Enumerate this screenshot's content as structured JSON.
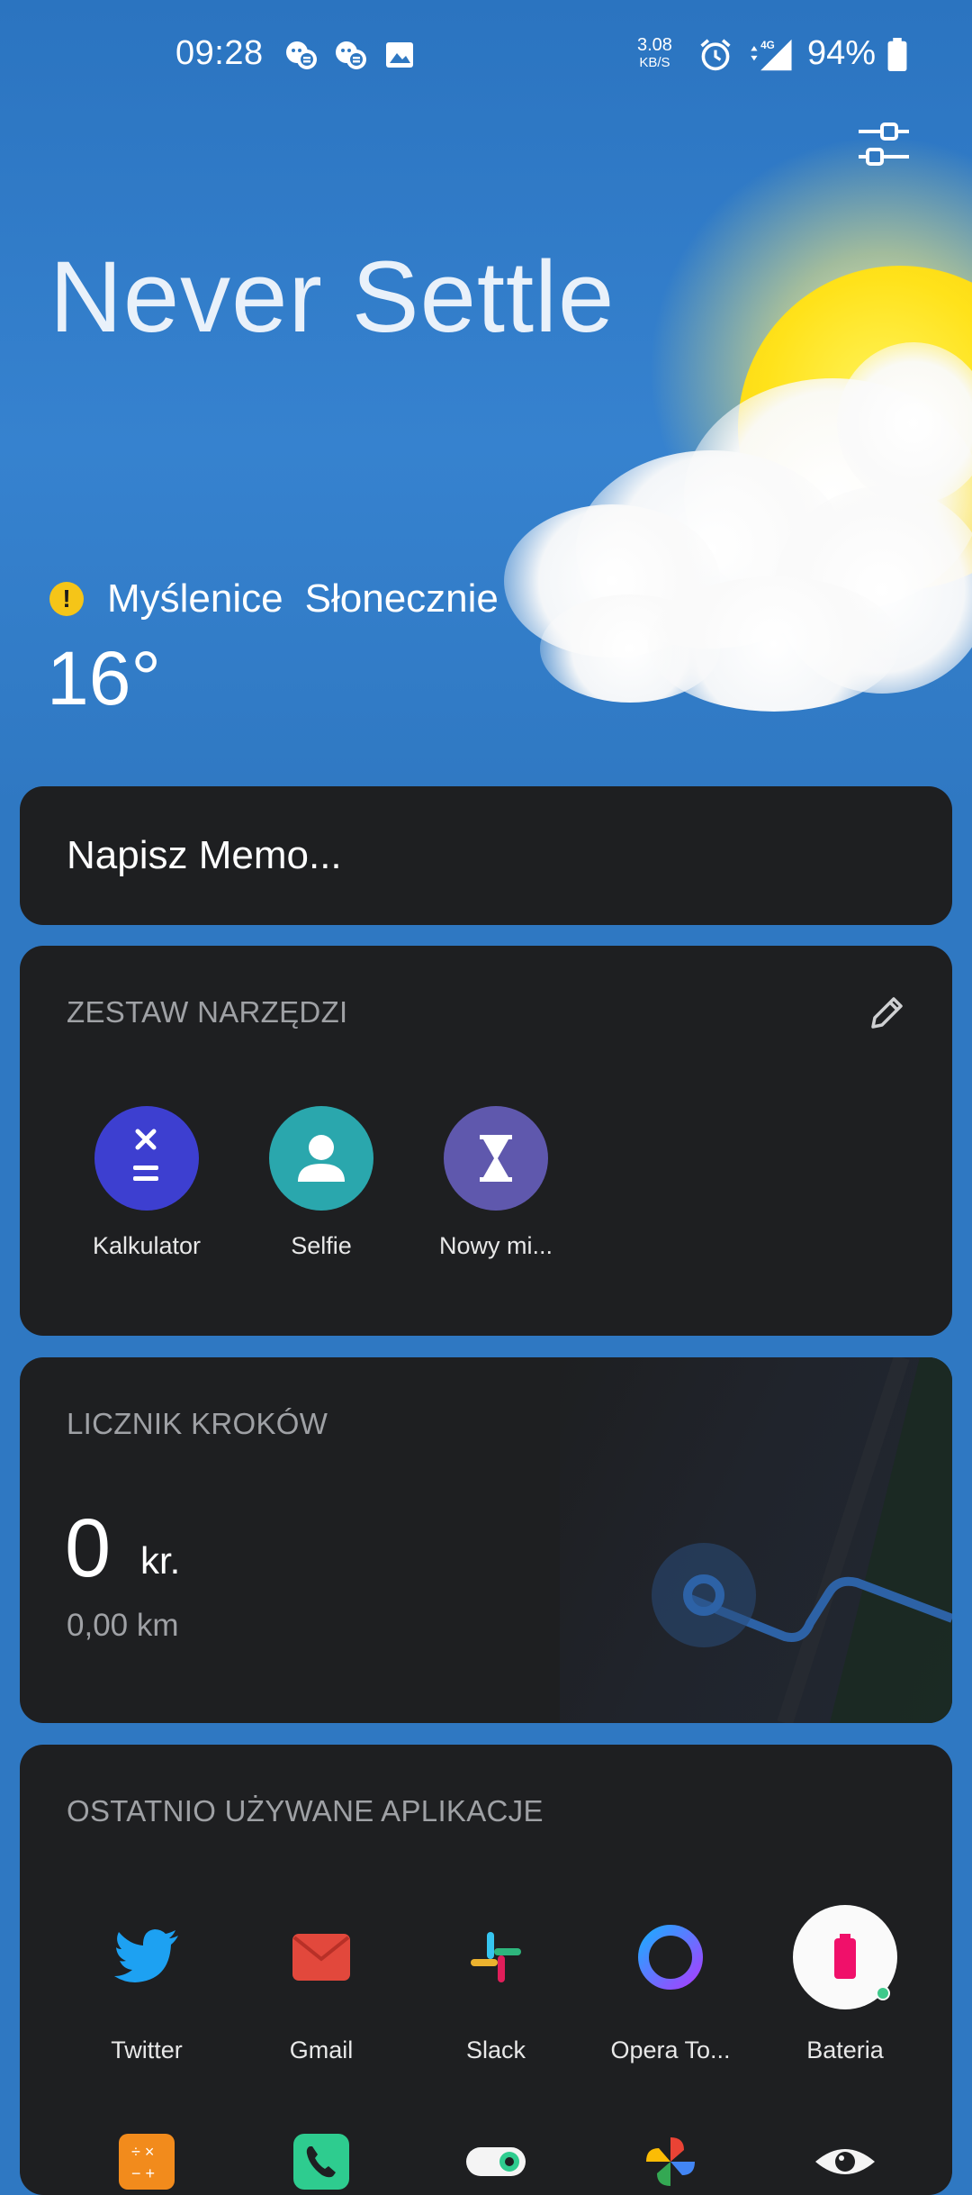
{
  "status_bar": {
    "time": "09:28",
    "net_speed_value": "3.08",
    "net_speed_unit": "KB/S",
    "network": "4G",
    "battery": "94%"
  },
  "header": {
    "slogan": "Never Settle"
  },
  "weather": {
    "city": "Myślenice",
    "condition": "Słonecznie",
    "temperature": "16°",
    "warning_icon": "!"
  },
  "memo": {
    "placeholder": "Napisz Memo..."
  },
  "toolbox": {
    "title": "ZESTAW NARZĘDZI",
    "items": [
      {
        "label": "Kalkulator",
        "icon": "calculator-icon",
        "color": "#3d3fd0"
      },
      {
        "label": "Selfie",
        "icon": "selfie-icon",
        "color": "#2aa7ad"
      },
      {
        "label": "Nowy mi...",
        "icon": "hourglass-icon",
        "color": "#5f58ad"
      }
    ]
  },
  "steps": {
    "title": "LICZNIK KROKÓW",
    "count": "0",
    "unit": "kr.",
    "distance": "0,00 km"
  },
  "recent_apps": {
    "title": "OSTATNIO UŻYWANE APLIKACJE",
    "row1": [
      {
        "label": "Twitter",
        "icon": "twitter-icon"
      },
      {
        "label": "Gmail",
        "icon": "gmail-icon"
      },
      {
        "label": "Slack",
        "icon": "slack-icon"
      },
      {
        "label": "Opera To...",
        "icon": "opera-touch-icon"
      },
      {
        "label": "Bateria",
        "icon": "battery-app-icon"
      }
    ],
    "row2": [
      {
        "icon": "calculator-app-icon"
      },
      {
        "icon": "phone-app-icon"
      },
      {
        "icon": "toggle-app-icon"
      },
      {
        "icon": "pinwheel-app-icon"
      },
      {
        "icon": "eye-app-icon"
      }
    ]
  },
  "colors": {
    "background": "#2f78c2",
    "card": "#1e1f21",
    "muted_text": "#9fa1a5"
  }
}
